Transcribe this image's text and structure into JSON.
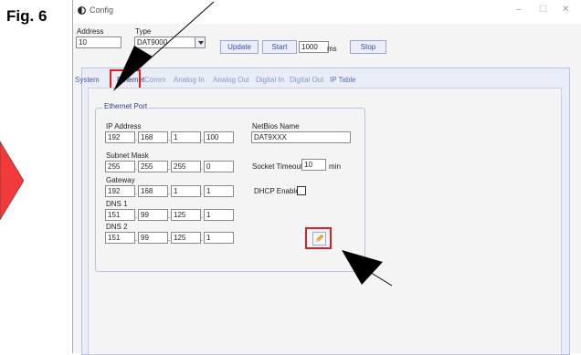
{
  "figure_label": "Fig. 6",
  "window": {
    "title": "Config",
    "minimize": "–",
    "maximize": "☐",
    "close": "✕"
  },
  "toolbar": {
    "address_label": "Address",
    "address_value": "10",
    "type_label": "Type",
    "type_value": "DAT9000",
    "update_label": "Update",
    "start_label": "Start",
    "interval_value": "1000",
    "interval_unit": "ms",
    "stop_label": "Stop"
  },
  "tabs": [
    {
      "label": "System"
    },
    {
      "label": "Ethernet"
    },
    {
      "label": "Comm"
    },
    {
      "label": "Analog In"
    },
    {
      "label": "Analog Out"
    },
    {
      "label": "Digital In"
    },
    {
      "label": "Digital Out"
    },
    {
      "label": "IP Table"
    }
  ],
  "ethernet": {
    "group_title": "Ethernet Port",
    "ip_label": "IP Address",
    "ip": [
      "192",
      "168",
      "1",
      "100"
    ],
    "subnet_label": "Subnet Mask",
    "subnet": [
      "255",
      "255",
      "255",
      "0"
    ],
    "gateway_label": "Gateway",
    "gateway": [
      "192",
      "168",
      "1",
      "1"
    ],
    "dns1_label": "DNS 1",
    "dns1": [
      "151",
      "99",
      "125",
      "1"
    ],
    "dns2_label": "DNS 2",
    "dns2": [
      "151",
      "99",
      "125",
      "1"
    ],
    "netbios_label": "NetBios Name",
    "netbios_value": "DAT9XXX",
    "socket_timeout_label": "Socket Timeout",
    "socket_timeout_value": "10",
    "socket_timeout_unit": "min",
    "dhcp_label": "DHCP Enable",
    "dhcp_checked": false
  },
  "colors": {
    "highlight": "#e02020",
    "tab_active": "#2a3e9a",
    "panel_bg": "#e8edf8"
  },
  "icons": [
    "pencil-icon",
    "window-icon",
    "dropdown-arrow-icon",
    "callout-arrow-icon"
  ]
}
